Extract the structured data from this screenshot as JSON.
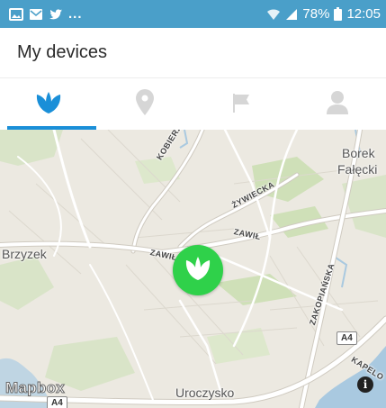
{
  "status_bar": {
    "notification_icons": [
      "gallery-icon",
      "email-icon",
      "twitter-icon"
    ],
    "overflow": "...",
    "battery_percent": "78%",
    "time": "12:05",
    "background": "#4a9fc9"
  },
  "header": {
    "title": "My devices"
  },
  "tabs": [
    {
      "icon": "leaf-icon",
      "active": true
    },
    {
      "icon": "location-pin-icon",
      "active": false
    },
    {
      "icon": "flag-icon",
      "active": false
    },
    {
      "icon": "person-icon",
      "active": false
    }
  ],
  "colors": {
    "accent": "#1a8fd8",
    "marker": "#2fd14a",
    "inactive_icon": "#d6d6d6"
  },
  "map": {
    "labels": {
      "brzyzek": "Brzyzek",
      "borek": "Borek",
      "falecki": "Fałęcki",
      "uroczysko": "Uroczysko",
      "kobierzynska": "KOBIERZYŃSKA",
      "zywiecka": "ŻYWIECKA",
      "zawila_1": "ZAWIŁA",
      "zawila_2": "ZAWIŁ",
      "zakopianska": "ZAKOPIAŃSKA",
      "kapelo": "KAPELO"
    },
    "road_shields": {
      "a4_right": "A4",
      "a4_bottom": "A4"
    },
    "attribution": "Mapbox",
    "info_button": "i",
    "device_marker_icon": "leaf-icon"
  }
}
